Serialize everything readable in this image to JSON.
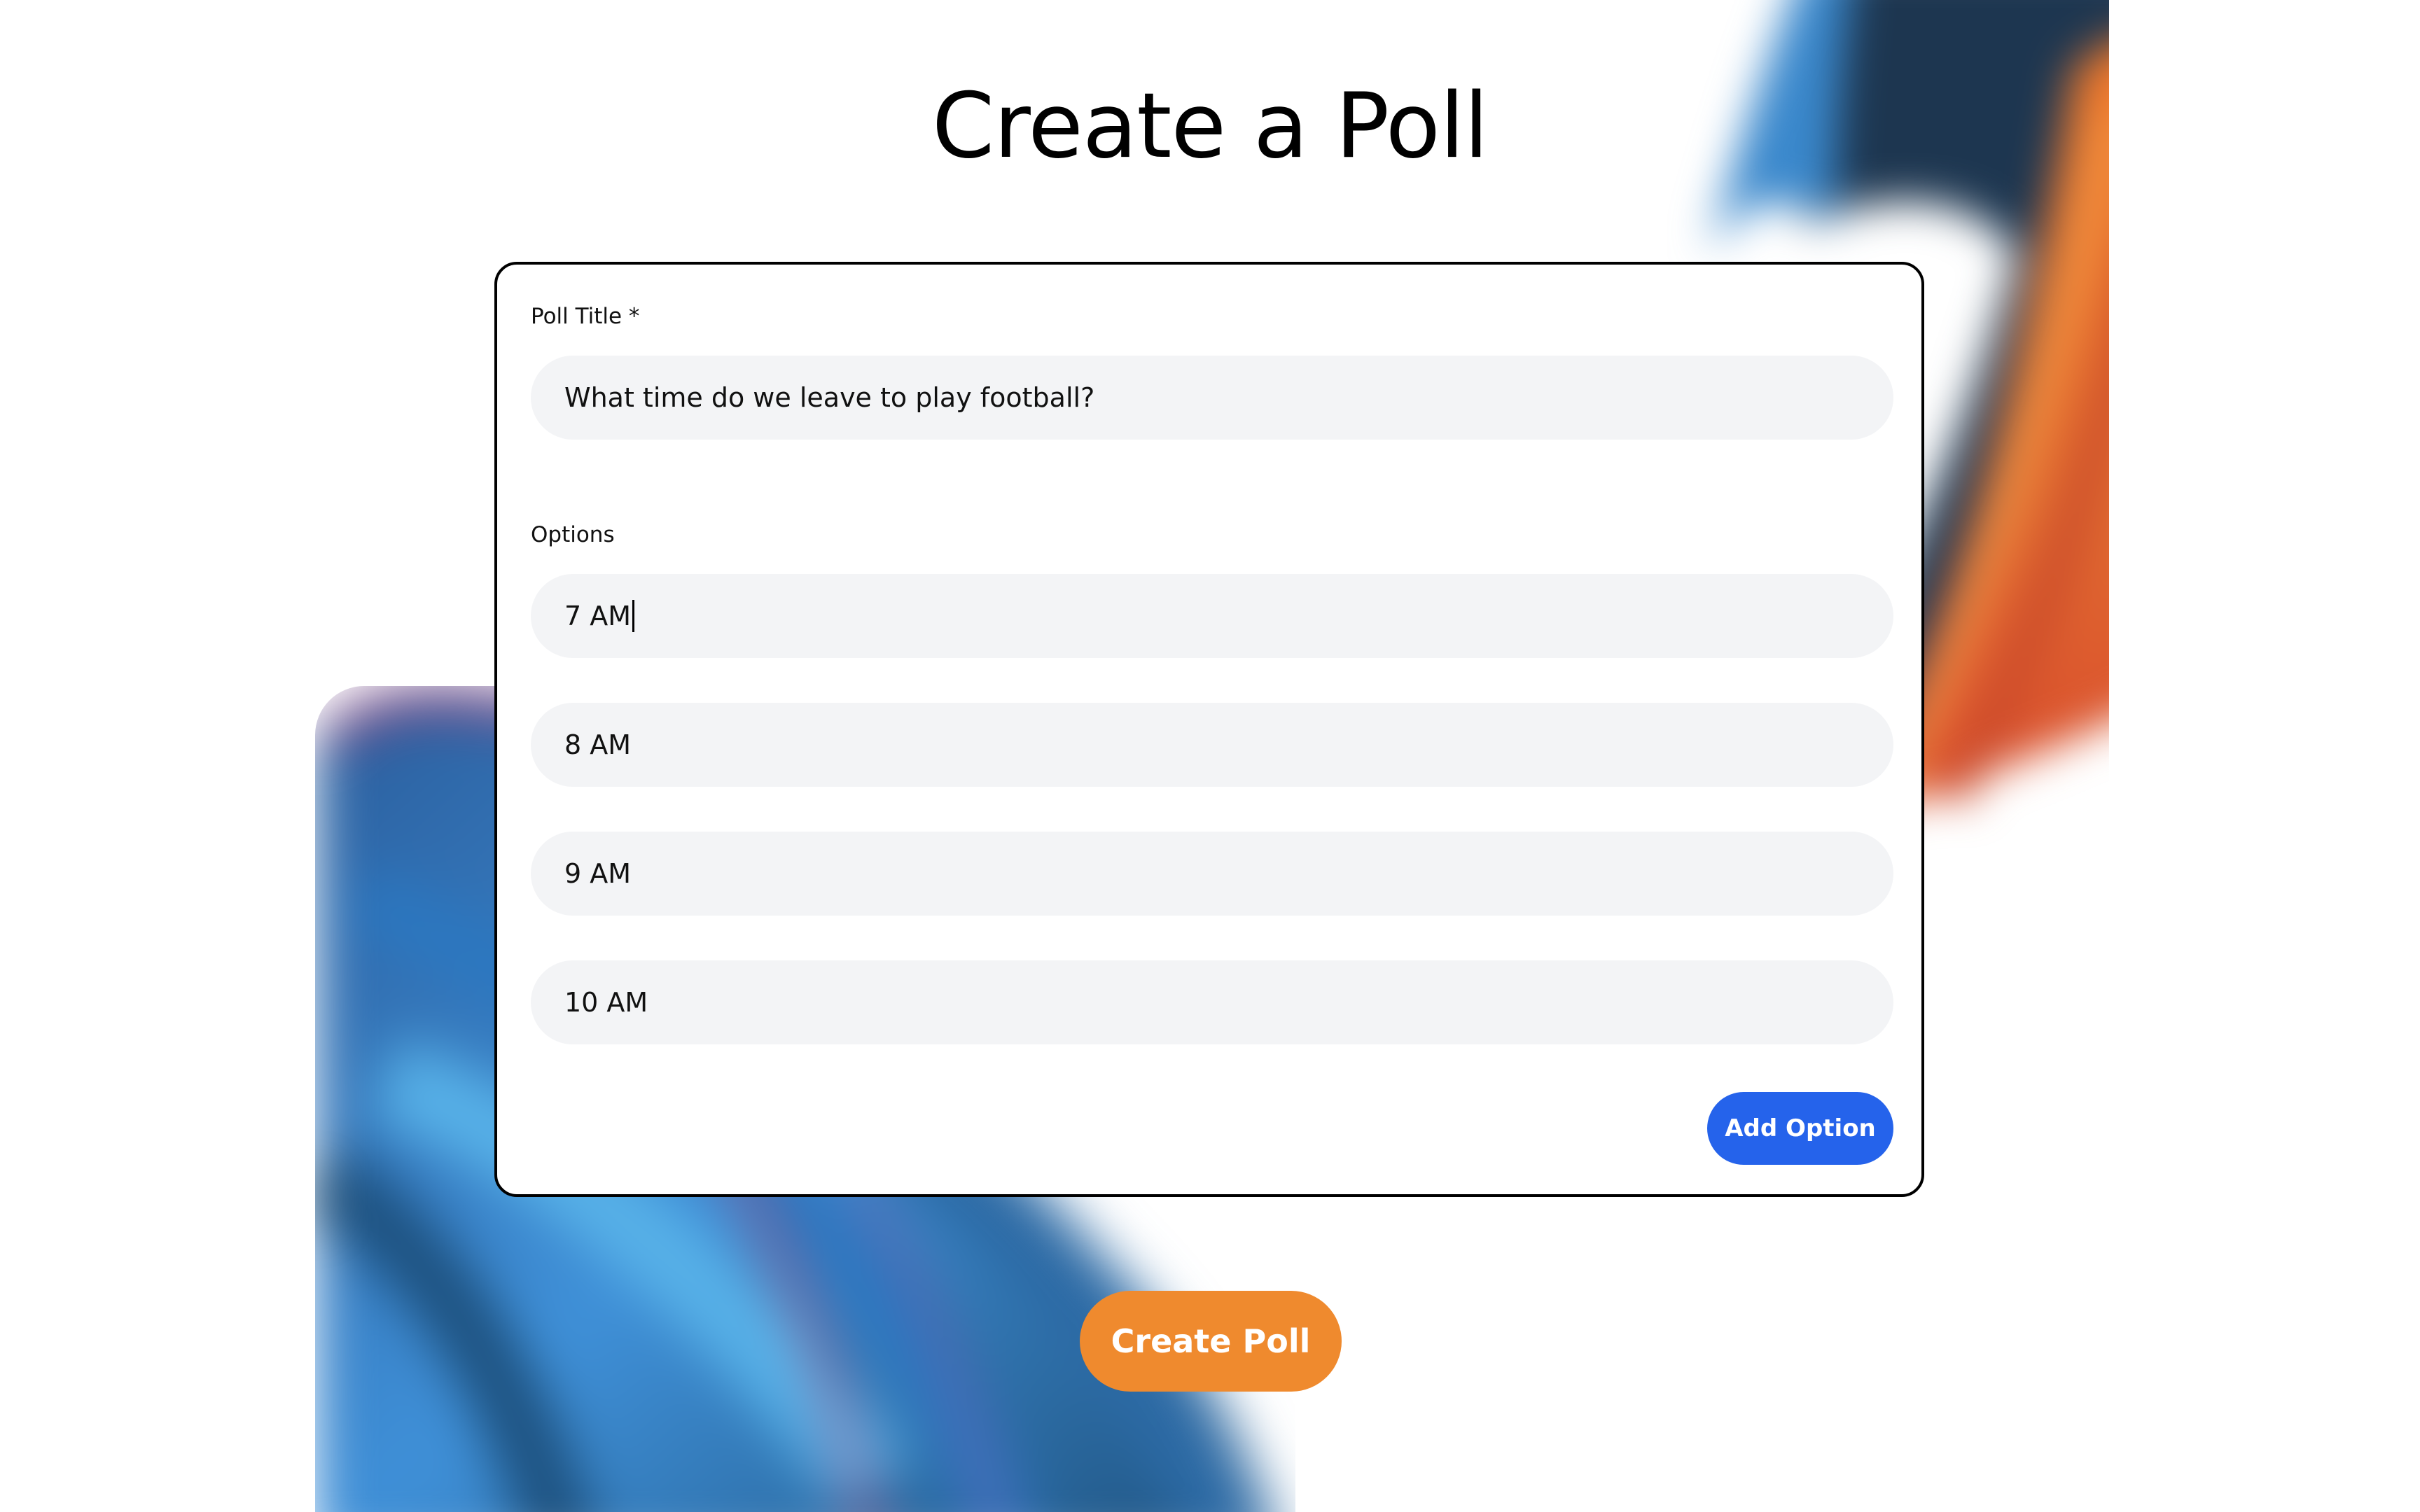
{
  "page": {
    "title": "Create a Poll"
  },
  "form": {
    "poll_title_label": "Poll Title *",
    "poll_title_value": "What time do we leave to play football?",
    "options_label": "Options",
    "options": [
      {
        "value": "7 AM",
        "focused": true
      },
      {
        "value": "8 AM",
        "focused": false
      },
      {
        "value": "9 AM",
        "focused": false
      },
      {
        "value": "10 AM",
        "focused": false
      }
    ],
    "add_option_label": "Add Option"
  },
  "actions": {
    "create_poll_label": "Create Poll"
  },
  "colors": {
    "primary_blue": "#2563eb",
    "accent_orange": "#ef8a2e",
    "input_background": "#f3f4f6",
    "card_border": "#000000"
  }
}
